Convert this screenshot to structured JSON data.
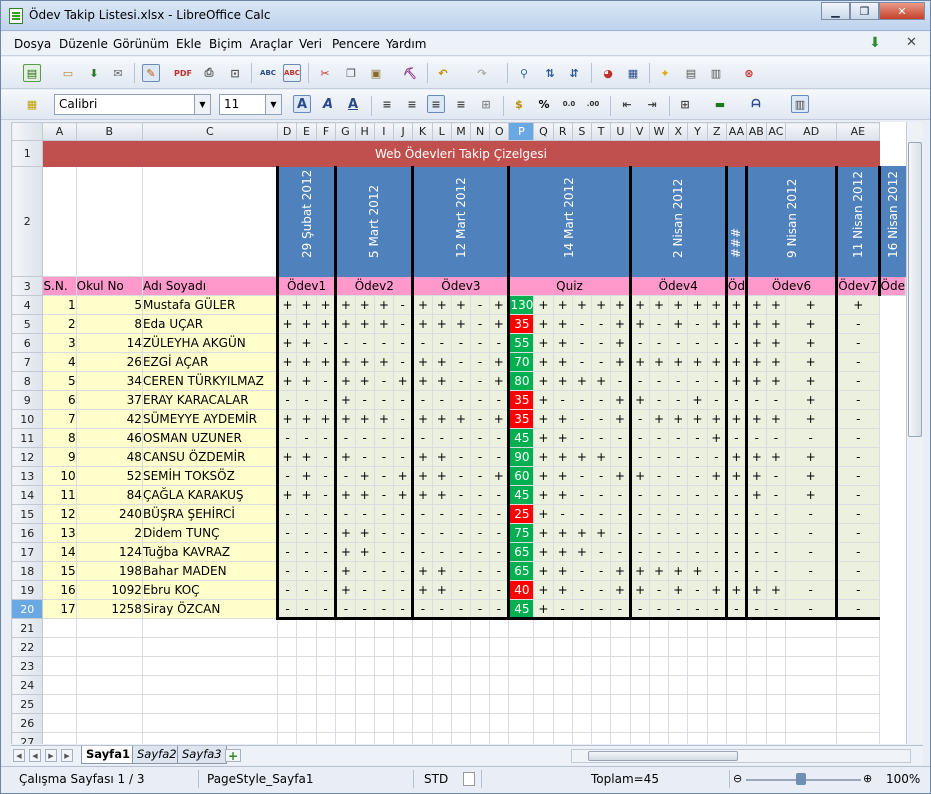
{
  "window": {
    "title": "Ödev Takip Listesi.xlsx - LibreOffice Calc",
    "minimize": "▁",
    "maximize": "❐",
    "close": "✕"
  },
  "menu": [
    "Dosya",
    "Düzenle",
    "Görünüm",
    "Ekle",
    "Biçim",
    "Araçlar",
    "Veri",
    "Pencere",
    "Yardım"
  ],
  "format_toolbar": {
    "font_name": "Calibri",
    "font_size": "11"
  },
  "columns": [
    "A",
    "B",
    "C",
    "D",
    "E",
    "F",
    "G",
    "H",
    "I",
    "J",
    "K",
    "L",
    "M",
    "N",
    "O",
    "P",
    "Q",
    "R",
    "S",
    "T",
    "U",
    "V",
    "W",
    "X",
    "Y",
    "Z",
    "AA",
    "AB",
    "AC",
    "AD",
    "AE"
  ],
  "selected_column": "P",
  "sheet": {
    "title": "Web Ödevleri Takip Çizelgesi",
    "dates": [
      {
        "label": "29 Şubat 2012",
        "span": 3
      },
      {
        "label": "5 Mart 2012",
        "span": 4
      },
      {
        "label": "12 Mart 2012",
        "span": 5
      },
      {
        "label": "14 Mart 2012",
        "span": 6
      },
      {
        "label": "2 Nisan 2012",
        "span": 5
      },
      {
        "label": "###",
        "span": 1
      },
      {
        "label": "9 Nisan 2012",
        "span": 3
      },
      {
        "label": "11 Nisan 2012",
        "span": 1
      },
      {
        "label": "16 Nisan 2012",
        "span": 1
      }
    ],
    "headers": {
      "sn": "S.N.",
      "okul_no": "Okul No",
      "adi": "Adı Soyadı",
      "groups": [
        {
          "label": "Ödev1",
          "span": 3
        },
        {
          "label": "Ödev2",
          "span": 4
        },
        {
          "label": "Ödev3",
          "span": 5
        },
        {
          "label": "Quiz",
          "span": 6
        },
        {
          "label": "Ödev4",
          "span": 5
        },
        {
          "label": "Öd",
          "span": 1
        },
        {
          "label": "Ödev6",
          "span": 3
        },
        {
          "label": "Ödev7",
          "span": 1
        },
        {
          "label": "Öde",
          "span": 1
        }
      ]
    },
    "students": [
      {
        "sn": "1",
        "no": "5",
        "name": "Mustafa GÜLER",
        "marks": [
          "+",
          "+",
          "+",
          "+",
          "+",
          "+",
          "-",
          "+",
          "+",
          "+",
          "-",
          "+",
          "130",
          "+",
          "+",
          "+",
          "+",
          "+",
          "+",
          "+",
          "+",
          "+",
          "+",
          "+",
          "+",
          "+",
          "+",
          "+"
        ]
      },
      {
        "sn": "2",
        "no": "8",
        "name": "Eda UÇAR",
        "marks": [
          "+",
          "+",
          "+",
          "+",
          "+",
          "+",
          "-",
          "+",
          "+",
          "+",
          "-",
          "+",
          "35",
          "+",
          "+",
          "-",
          "-",
          "+",
          "+",
          "-",
          "+",
          "-",
          "+",
          "+",
          "+",
          "+",
          "+",
          "-"
        ]
      },
      {
        "sn": "3",
        "no": "14",
        "name": "ZÜLEYHA AKGÜN",
        "marks": [
          "+",
          "+",
          "-",
          "-",
          "-",
          "-",
          "-",
          "-",
          "-",
          "-",
          "-",
          "-",
          "55",
          "+",
          "+",
          "-",
          "-",
          "+",
          "-",
          "-",
          "-",
          "-",
          "-",
          "-",
          "+",
          "+",
          "+",
          "-"
        ]
      },
      {
        "sn": "4",
        "no": "26",
        "name": "EZGİ AÇAR",
        "marks": [
          "+",
          "+",
          "+",
          "+",
          "+",
          "+",
          "-",
          "+",
          "+",
          "-",
          "-",
          "+",
          "70",
          "+",
          "+",
          "-",
          "-",
          "+",
          "+",
          "+",
          "+",
          "+",
          "+",
          "+",
          "+",
          "+",
          "+",
          "-"
        ]
      },
      {
        "sn": "5",
        "no": "34",
        "name": "CEREN TÜRKYILMAZ",
        "marks": [
          "+",
          "+",
          "-",
          "+",
          "+",
          "-",
          "+",
          "+",
          "+",
          "-",
          "-",
          "+",
          "80",
          "+",
          "+",
          "+",
          "+",
          "-",
          "-",
          "-",
          "-",
          "-",
          "-",
          "+",
          "+",
          "+",
          "+",
          "-"
        ]
      },
      {
        "sn": "6",
        "no": "37",
        "name": "ERAY KARACALAR",
        "marks": [
          "-",
          "-",
          "-",
          "+",
          "-",
          "-",
          "-",
          "-",
          "-",
          "-",
          "-",
          "-",
          "35",
          "+",
          "-",
          "-",
          "-",
          "+",
          "+",
          "-",
          "-",
          "+",
          "-",
          "-",
          "-",
          "-",
          "+",
          "-"
        ]
      },
      {
        "sn": "7",
        "no": "42",
        "name": "SÜMEYYE AYDEMİR",
        "marks": [
          "+",
          "+",
          "+",
          "+",
          "+",
          "+",
          "-",
          "+",
          "+",
          "+",
          "-",
          "+",
          "35",
          "+",
          "+",
          "-",
          "-",
          "+",
          "-",
          "+",
          "+",
          "+",
          "+",
          "+",
          "+",
          "+",
          "+",
          "-"
        ]
      },
      {
        "sn": "8",
        "no": "46",
        "name": "OSMAN UZUNER",
        "marks": [
          "-",
          "-",
          "-",
          "-",
          "-",
          "-",
          "-",
          "-",
          "-",
          "-",
          "-",
          "-",
          "45",
          "+",
          "+",
          "-",
          "-",
          "-",
          "-",
          "-",
          "-",
          "-",
          "+",
          "-",
          "-",
          "-",
          "-",
          "-"
        ]
      },
      {
        "sn": "9",
        "no": "48",
        "name": "CANSU ÖZDEMİR",
        "marks": [
          "+",
          "+",
          "-",
          "+",
          "-",
          "-",
          "-",
          "+",
          "+",
          "-",
          "-",
          "-",
          "90",
          "+",
          "+",
          "+",
          "+",
          "-",
          "-",
          "-",
          "-",
          "-",
          "-",
          "+",
          "+",
          "+",
          "+",
          "-"
        ]
      },
      {
        "sn": "10",
        "no": "52",
        "name": "SEMİH TOKSÖZ",
        "marks": [
          "-",
          "+",
          "-",
          "-",
          "+",
          "-",
          "+",
          "+",
          "+",
          "-",
          "-",
          "+",
          "60",
          "+",
          "+",
          "-",
          "-",
          "+",
          "+",
          "-",
          "-",
          "-",
          "+",
          "+",
          "+",
          "-",
          "+",
          "-"
        ]
      },
      {
        "sn": "11",
        "no": "84",
        "name": "ÇAĞLA KARAKUŞ",
        "marks": [
          "+",
          "+",
          "-",
          "+",
          "+",
          "-",
          "+",
          "+",
          "+",
          "-",
          "-",
          "-",
          "45",
          "+",
          "+",
          "-",
          "-",
          "-",
          "-",
          "-",
          "-",
          "-",
          "-",
          "-",
          "+",
          "-",
          "+",
          "-"
        ]
      },
      {
        "sn": "12",
        "no": "240",
        "name": "BÜŞRA ŞEHİRCİ",
        "marks": [
          "-",
          "-",
          "-",
          "-",
          "-",
          "-",
          "-",
          "-",
          "-",
          "-",
          "-",
          "-",
          "25",
          "+",
          "-",
          "-",
          "-",
          "-",
          "-",
          "-",
          "-",
          "-",
          "-",
          "-",
          "-",
          "-",
          "-",
          "-"
        ]
      },
      {
        "sn": "13",
        "no": "2",
        "name": "Didem TUNÇ",
        "marks": [
          "-",
          "-",
          "-",
          "+",
          "+",
          "-",
          "-",
          "-",
          "-",
          "-",
          "-",
          "-",
          "75",
          "+",
          "+",
          "+",
          "+",
          "-",
          "-",
          "-",
          "-",
          "-",
          "-",
          "-",
          "-",
          "-",
          "-",
          "-"
        ]
      },
      {
        "sn": "14",
        "no": "124",
        "name": "Tuğba KAVRAZ",
        "marks": [
          "-",
          "-",
          "-",
          "+",
          "+",
          "-",
          "-",
          "-",
          "-",
          "-",
          "-",
          "-",
          "65",
          "+",
          "+",
          "+",
          "-",
          "-",
          "-",
          "-",
          "-",
          "-",
          "-",
          "-",
          "-",
          "-",
          "-",
          "-"
        ]
      },
      {
        "sn": "15",
        "no": "198",
        "name": "Bahar MADEN",
        "marks": [
          "-",
          "-",
          "-",
          "+",
          "-",
          "-",
          "-",
          "+",
          "+",
          "-",
          "-",
          "-",
          "65",
          "+",
          "+",
          "-",
          "-",
          "+",
          "+",
          "+",
          "+",
          "+",
          "-",
          "-",
          "-",
          "-",
          "-",
          "-"
        ]
      },
      {
        "sn": "16",
        "no": "1092",
        "name": "Ebru KOÇ",
        "marks": [
          "-",
          "-",
          "-",
          "+",
          "-",
          "-",
          "-",
          "+",
          "+",
          "-",
          "-",
          "-",
          "40",
          "+",
          "+",
          "-",
          "-",
          "+",
          "+",
          "-",
          "+",
          "-",
          "+",
          "+",
          "+",
          "+",
          "-",
          "-"
        ]
      },
      {
        "sn": "17",
        "no": "1258",
        "name": "Siray ÖZCAN",
        "marks": [
          "-",
          "-",
          "-",
          "-",
          "-",
          "-",
          "-",
          "-",
          "-",
          "-",
          "-",
          "-",
          "45",
          "+",
          "-",
          "-",
          "-",
          "-",
          "-",
          "-",
          "-",
          "-",
          "-",
          "-",
          "-",
          "-",
          "-",
          "-"
        ]
      }
    ],
    "quiz_fail_values": [
      "35",
      "25",
      "40"
    ]
  },
  "empty_rows": [
    "21",
    "22",
    "23",
    "24",
    "25",
    "26",
    "27"
  ],
  "selected_row": "20",
  "sheet_tabs": [
    "Sayfa1",
    "Sayfa2",
    "Sayfa3"
  ],
  "active_tab": "Sayfa1",
  "status": {
    "sheet": "Çalışma Sayfası 1 / 3",
    "page_style": "PageStyle_Sayfa1",
    "mode": "STD",
    "sum": "Toplam=45",
    "zoom": "100%"
  },
  "colors": {
    "title_bg": "#c0504d",
    "date_bg": "#4f81bd",
    "header_bg": "#ff99cc",
    "name_bg": "#ffffcc",
    "mark_bg": "#ebf1de",
    "quiz_pass": "#00b050",
    "quiz_fail": "#ff0000"
  }
}
